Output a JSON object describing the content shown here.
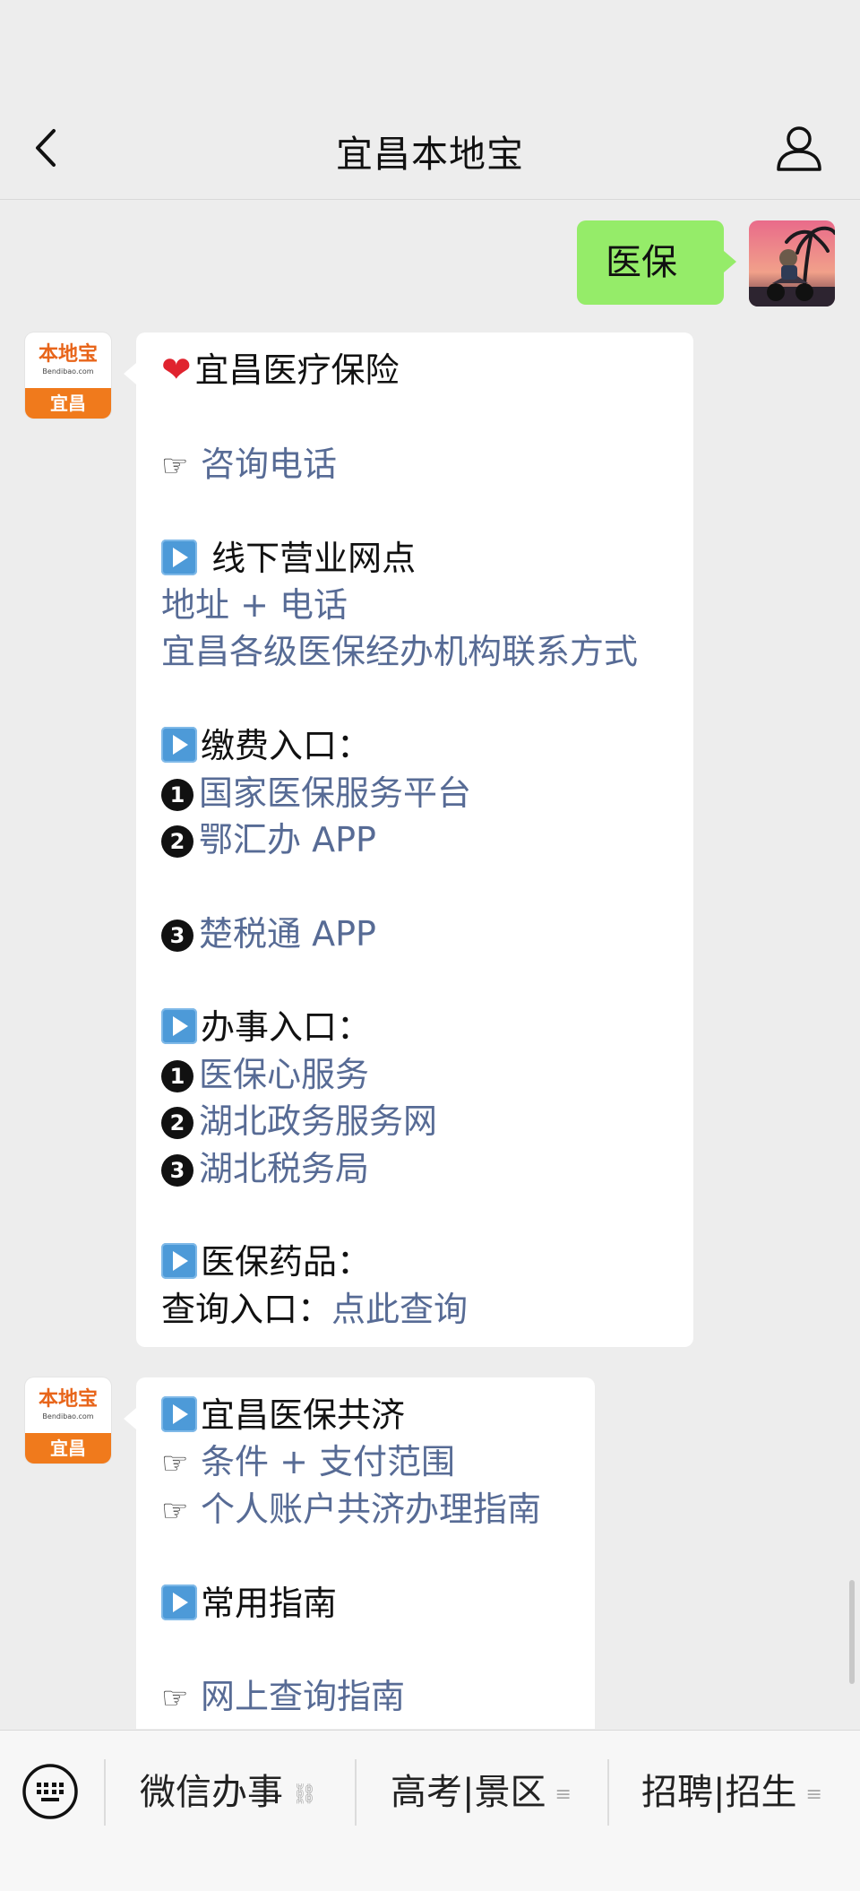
{
  "header": {
    "title": "宜昌本地宝"
  },
  "outgoing": {
    "text": "医保"
  },
  "bot_avatar": {
    "logo_cn": "本地宝",
    "logo_en": "Bendibao.com",
    "city": "宜昌"
  },
  "message1": {
    "heading": "宜昌医疗保险",
    "consult": "咨询电话",
    "offline_title": " 线下营业网点",
    "offline_link1": "地址 + 电话",
    "offline_link2": "宜昌各级医保经办机构联系方式",
    "pay_title": "缴费入口：",
    "pay_items": [
      "国家医保服务平台",
      "鄂汇办 APP",
      "楚税通 APP"
    ],
    "affairs_title": "办事入口：",
    "affairs_items": [
      "医保心服务",
      "湖北政务服务网",
      "湖北税务局"
    ],
    "drugs_title": "医保药品：",
    "query_label": "查询入口：",
    "query_link": "点此查询"
  },
  "message2": {
    "title": "宜昌医保共济",
    "links": [
      "条件 + 支付范围",
      "个人账户共济办理指南"
    ],
    "guide_title": "常用指南",
    "guide_link": "网上查询指南"
  },
  "bottom_menu": {
    "items": [
      {
        "label": "微信办事",
        "suffix": "🔗"
      },
      {
        "label": "高考|景区",
        "suffix": "≡"
      },
      {
        "label": "招聘|招生",
        "suffix": "≡"
      }
    ]
  },
  "colors": {
    "link": "#576b95",
    "outgoing_bubble": "#95ec69",
    "brand_orange": "#f07a1c"
  }
}
